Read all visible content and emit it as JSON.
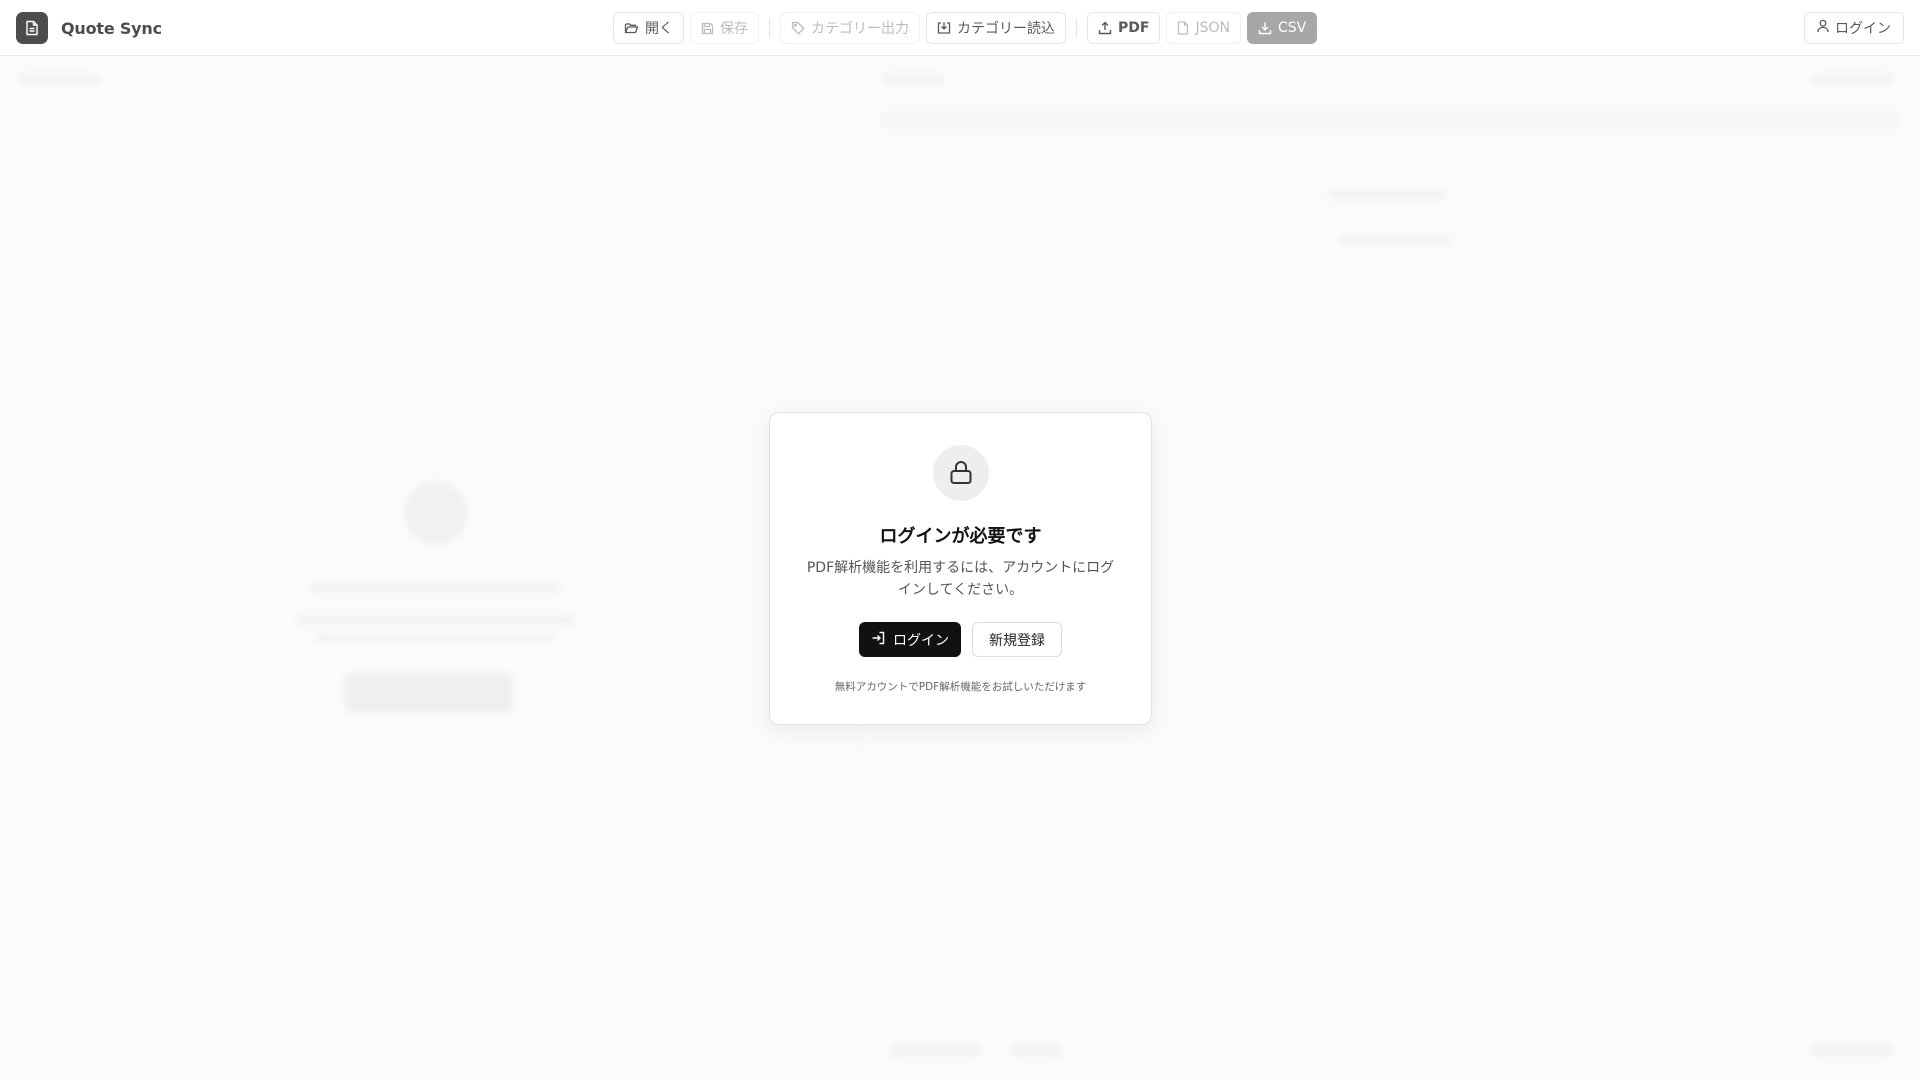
{
  "app": {
    "title": "Quote Sync"
  },
  "toolbar": {
    "open_label": "開く",
    "save_label": "保存",
    "category_export_label": "カテゴリー出力",
    "category_import_label": "カテゴリー読込",
    "pdf_label": "PDF",
    "json_label": "JSON",
    "csv_label": "CSV"
  },
  "header_right": {
    "login_label": "ログイン"
  },
  "modal": {
    "title": "ログインが必要です",
    "description": "PDF解析機能を利用するには、アカウントにログインしてください。",
    "login_button": "ログイン",
    "signup_button": "新規登録",
    "note": "無料アカウントでPDF解析機能をお試しいただけます"
  },
  "icons": {
    "logo": "document-icon",
    "open": "folder-open-icon",
    "save": "save-icon",
    "category_export": "tag-icon",
    "category_import": "download-box-icon",
    "pdf": "upload-icon",
    "json": "file-icon",
    "csv": "download-icon",
    "user": "user-icon",
    "lock": "lock-icon",
    "login": "log-in-icon"
  },
  "colors": {
    "primary": "#111111",
    "muted_button": "#8a8a8a",
    "background": "#fafafa"
  }
}
